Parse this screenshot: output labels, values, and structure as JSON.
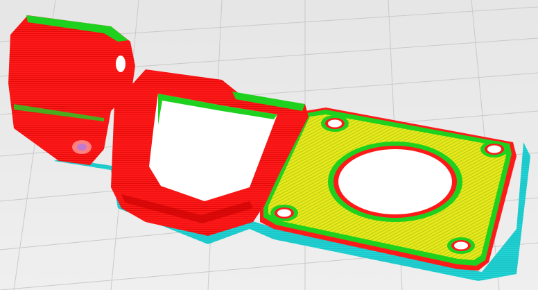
{
  "app": {
    "view": "layer-view"
  },
  "colors": {
    "background": "#ececec",
    "grid_line": "#c9c9c9",
    "wall_outer": "#ff1a1a",
    "wall_inner": "#1fd11f",
    "infill": "#e8e81a",
    "skirt": "#22d7d7",
    "shadow": "#9a0000",
    "hole": "#ffffff"
  },
  "scene": {
    "object": "printed-part-toolpath-preview",
    "layers_visible": true
  }
}
